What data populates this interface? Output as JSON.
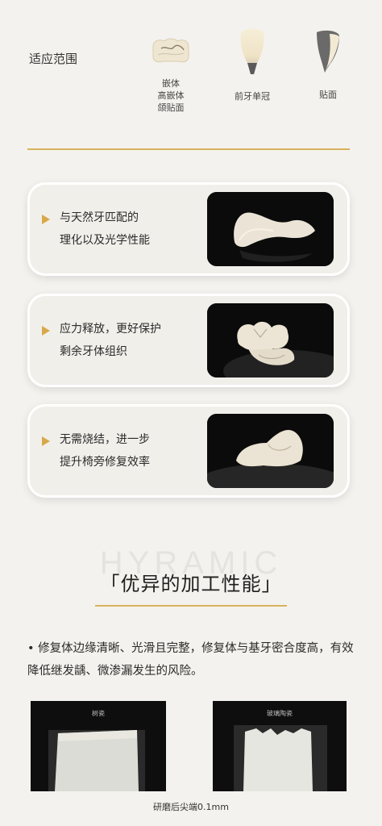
{
  "indications": {
    "section_label": "适应范围",
    "items": [
      {
        "lines": [
          "嵌体",
          "高嵌体",
          "颌贴面"
        ],
        "icon": "inlay-tooth-icon"
      },
      {
        "lines": [
          "前牙单冠"
        ],
        "icon": "anterior-crown-icon"
      },
      {
        "lines": [
          "贴面"
        ],
        "icon": "veneer-icon"
      }
    ]
  },
  "features": [
    {
      "lines": [
        "与天然牙匹配的",
        "理化以及光学性能"
      ],
      "image": "veneer-shell-photo"
    },
    {
      "lines": [
        "应力释放，更好保护",
        "剩余牙体组织"
      ],
      "image": "molar-onlay-photo"
    },
    {
      "lines": [
        "无需烧结，进一步",
        "提升椅旁修复效率"
      ],
      "image": "overlay-restoration-photo"
    }
  ],
  "processing": {
    "watermark": "HYRAMIC",
    "heading": "「优异的加工性能」",
    "bullet": "• 修复体边缘清晰、光滑且完整，修复体与基牙密合度高，有效降低继发龋、微渗漏发生的风险。",
    "samples": [
      {
        "label": "树瓷"
      },
      {
        "label": "玻璃陶瓷"
      }
    ],
    "caption": "研磨后尖端0.1mm"
  },
  "colors": {
    "accent_gold": "#d8b35c",
    "arrow": "#d8a84a",
    "background": "#f4f2ee"
  }
}
